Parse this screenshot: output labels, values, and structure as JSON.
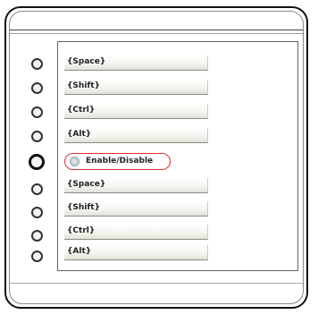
{
  "keys_top": [
    "{Space}",
    "{Shift}",
    "{Ctrl}",
    "{Alt}"
  ],
  "toggle_label": "Enable/Disable",
  "keys_bottom": [
    "{Space}",
    "{Shift}",
    "{Ctrl}",
    "{Alt}"
  ],
  "colors": {
    "toggle_outline": "#e03030"
  }
}
